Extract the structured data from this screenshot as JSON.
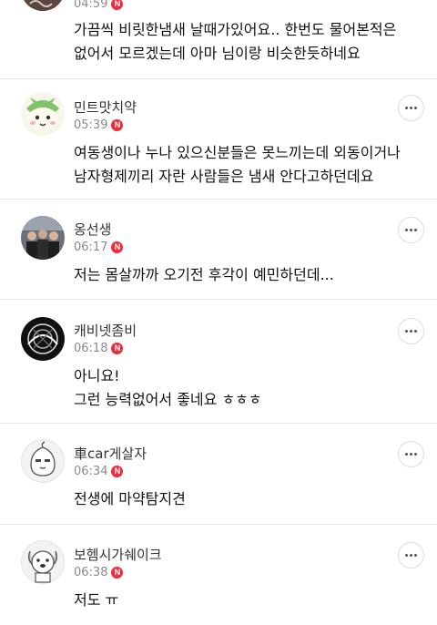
{
  "comments": [
    {
      "nickname": "",
      "time": "04:59",
      "badge": "N",
      "avatar": "partial-avatar",
      "text": "가끔씩 비릿한냄새 날때가있어요.. 한번도 물어본적은\n없어서 모르겠는데 아마 님이랑 비슷한듯하네요"
    },
    {
      "nickname": "민트맛치약",
      "time": "05:39",
      "badge": "N",
      "avatar": "cartoon-character-avatar",
      "text": "여동생이나 누나 있으신분들은 못느끼는데 외동이거나\n남자형제끼리 자란 사람들은 냄새 안다고하던데요"
    },
    {
      "nickname": "옹선생",
      "time": "06:17",
      "badge": "N",
      "avatar": "group-photo-avatar",
      "text": "저는 몸살까까 오기전 후각이 예민하던데..."
    },
    {
      "nickname": "캐비넷좀비",
      "time": "06:18",
      "badge": "N",
      "avatar": "dark-graphic-avatar",
      "text": "아니요!\n그런 능력없어서 좋네요 ㅎㅎㅎ"
    },
    {
      "nickname": "車car게살자",
      "time": "06:34",
      "badge": "N",
      "avatar": "default-peach-avatar",
      "text": "전생에 마약탐지견"
    },
    {
      "nickname": "보헴시가쉐이크",
      "time": "06:38",
      "badge": "N",
      "avatar": "default-dog-avatar",
      "text": "저도 ㅠ"
    }
  ],
  "colors": {
    "badge": "#ee2c3c",
    "time": "#8a8a8a",
    "divider": "#e9e9e9"
  }
}
